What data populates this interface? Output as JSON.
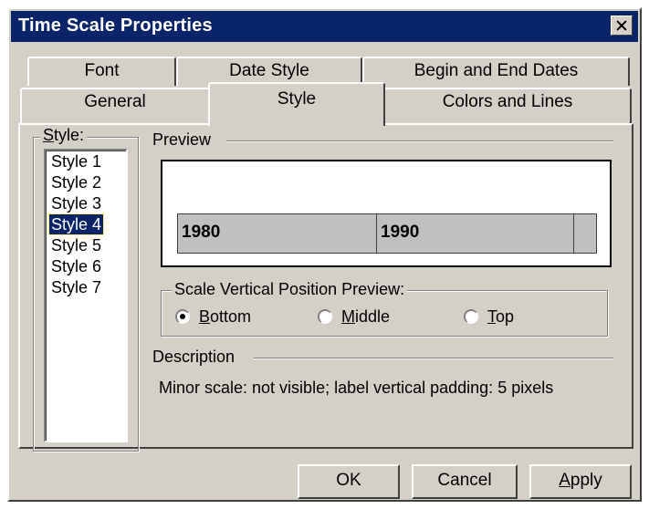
{
  "window": {
    "title": "Time Scale Properties"
  },
  "tabs": {
    "back_row": [
      "Font",
      "Date Style",
      "Begin and End Dates"
    ],
    "front_row": [
      "General",
      "Style",
      "Colors and Lines"
    ],
    "active": "Style"
  },
  "style_list": {
    "label": "Style:",
    "items": [
      "Style 1",
      "Style 2",
      "Style 3",
      "Style 4",
      "Style 5",
      "Style 6",
      "Style 7"
    ],
    "selected": "Style 4"
  },
  "preview": {
    "label": "Preview",
    "scale_labels": [
      "1980",
      "1990"
    ]
  },
  "scale_position": {
    "label": "Scale Vertical Position Preview:",
    "options": [
      "Bottom",
      "Middle",
      "Top"
    ],
    "selected": "Bottom"
  },
  "description": {
    "label": "Description",
    "text": "Minor scale: not visible; label vertical padding: 5 pixels"
  },
  "buttons": {
    "ok": "OK",
    "cancel": "Cancel",
    "apply": "Apply"
  },
  "colors": {
    "title_bar": "#0a246a",
    "face": "#d4d0c8",
    "selection": "#0a246a",
    "scale_fill": "#c0c0c0"
  }
}
